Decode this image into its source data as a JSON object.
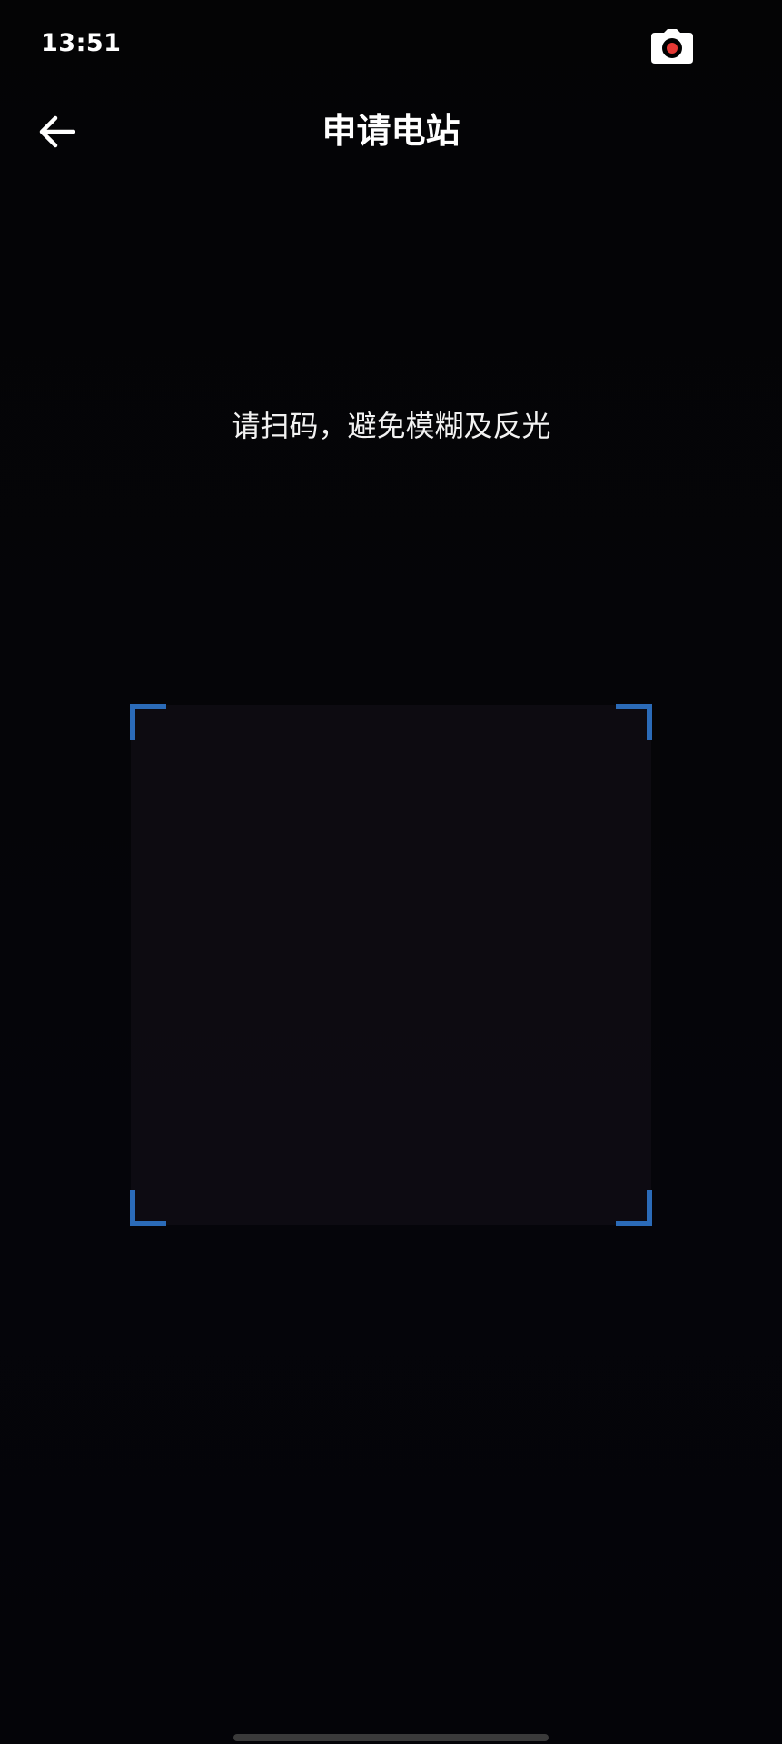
{
  "status_bar": {
    "time": "13:51",
    "recording_icon": "camera-record-icon",
    "recording_dot_color": "#e53935"
  },
  "header": {
    "back_icon": "arrow-left-icon",
    "title": "申请电站"
  },
  "scanner": {
    "hint": "请扫码，避免模糊及反光",
    "frame_corner_color": "#2b6bb8"
  }
}
